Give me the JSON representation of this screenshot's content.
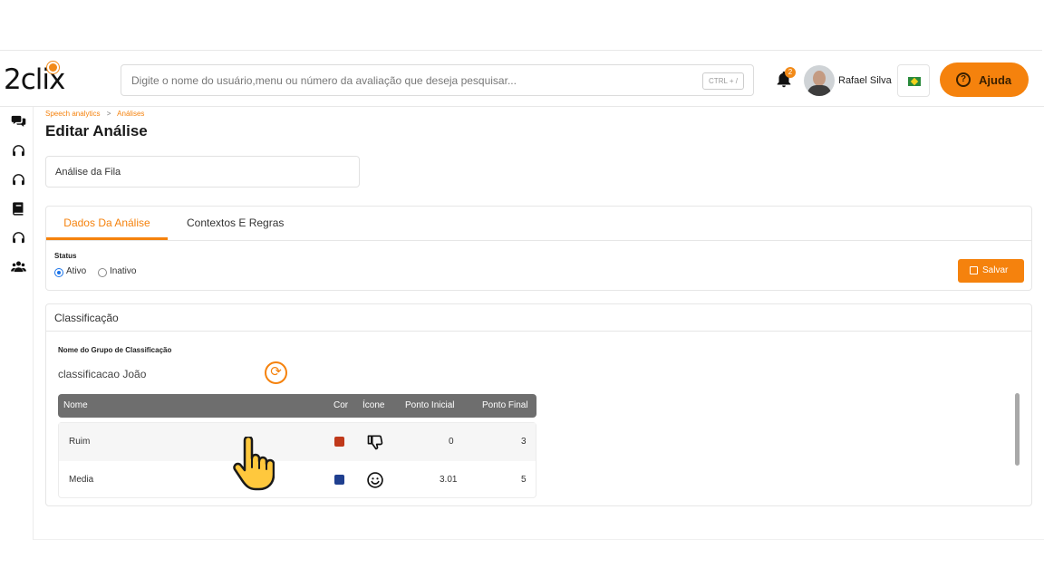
{
  "header": {
    "logo_text": "2clix",
    "search": {
      "placeholder": "Digite o nome do usuário,menu ou número da avaliação que deseja pesquisar...",
      "shortcut": "CTRL + /"
    },
    "notifications_count": "2",
    "user_name": "Rafael Silva",
    "help_label": "Ajuda",
    "help_icon": "question-icon",
    "accent_color": "#f5820d"
  },
  "sidebar": {
    "items": [
      {
        "icon": "chat-bubbles-icon"
      },
      {
        "icon": "headset-icon"
      },
      {
        "icon": "headset-icon"
      },
      {
        "icon": "book-icon"
      },
      {
        "icon": "headset-icon"
      },
      {
        "icon": "users-group-icon"
      }
    ]
  },
  "breadcrumb": {
    "parent": "Speech analytics",
    "separator": ">",
    "current": "Análises"
  },
  "page_title": "Editar Análise",
  "analysis_name": "Análise da Fila",
  "tabs": [
    {
      "label": "Dados Da Análise",
      "active": true
    },
    {
      "label": "Contextos E Regras",
      "active": false
    }
  ],
  "status": {
    "label": "Status",
    "options": [
      {
        "label": "Ativo",
        "checked": true
      },
      {
        "label": "Inativo",
        "checked": false
      }
    ]
  },
  "save_label": "Salvar",
  "classification": {
    "title": "Classificação",
    "group_label": "Nome do Grupo de Classificação",
    "group_value": "classificacao João",
    "columns": [
      "Nome",
      "Cor",
      "Ícone",
      "Ponto Inicial",
      "Ponto Final"
    ],
    "rows": [
      {
        "nome": "Ruim",
        "cor": "#c0391b",
        "icone": "thumbs-down-icon",
        "ponto_inicial": "0",
        "ponto_final": "3"
      },
      {
        "nome": "Media",
        "cor": "#1f3f8f",
        "icone": "smiley-icon",
        "ponto_inicial": "3.01",
        "ponto_final": "5"
      }
    ]
  }
}
